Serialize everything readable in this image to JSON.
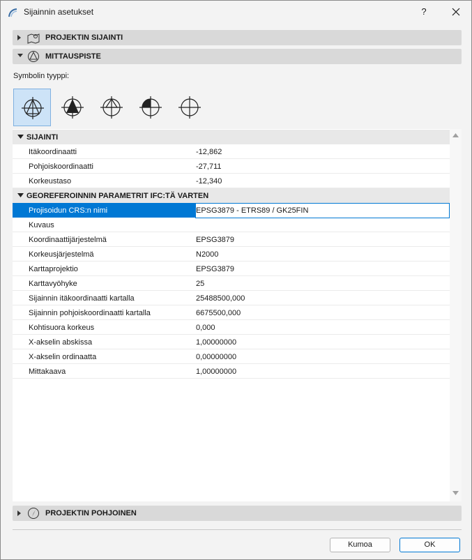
{
  "window": {
    "title": "Sijainnin asetukset",
    "help_label": "?"
  },
  "sections": {
    "project_location": "PROJEKTIN SIJAINTI",
    "survey_point": "MITTAUSPISTE",
    "project_north": "PROJEKTIN POHJOINEN"
  },
  "symbol": {
    "label": "Symbolin tyyppi:",
    "selected_index": 0,
    "options": [
      "survey-symbol-a-icon",
      "survey-symbol-b-icon",
      "survey-symbol-c-icon",
      "survey-symbol-d-icon",
      "survey-symbol-e-icon"
    ]
  },
  "location_group": {
    "title": "SIJAINTI",
    "rows": [
      {
        "name": "Itäkoordinaatti",
        "value": "-12,862"
      },
      {
        "name": "Pohjoiskoordinaatti",
        "value": "-27,711"
      },
      {
        "name": "Korkeustaso",
        "value": "-12,340"
      }
    ]
  },
  "georef_group": {
    "title": "GEOREFEROINNIN PARAMETRIT IFC:TÄ VARTEN",
    "selected_row": 0,
    "rows": [
      {
        "name": "Projisoidun CRS:n nimi",
        "value": "EPSG3879 - ETRS89 / GK25FIN"
      },
      {
        "name": "Kuvaus",
        "value": ""
      },
      {
        "name": "Koordinaattijärjestelmä",
        "value": "EPSG3879"
      },
      {
        "name": "Korkeusjärjestelmä",
        "value": "N2000"
      },
      {
        "name": "Karttaprojektio",
        "value": "EPSG3879"
      },
      {
        "name": "Karttavyöhyke",
        "value": "25"
      },
      {
        "name": "Sijainnin itäkoordinaatti kartalla",
        "value": "25488500,000"
      },
      {
        "name": "Sijainnin pohjoiskoordinaatti kartalla",
        "value": "6675500,000"
      },
      {
        "name": "Kohtisuora korkeus",
        "value": "0,000"
      },
      {
        "name": "X-akselin abskissa",
        "value": "1,00000000"
      },
      {
        "name": "X-akselin ordinaatta",
        "value": "0,00000000"
      },
      {
        "name": "Mittakaava",
        "value": "1,00000000"
      }
    ]
  },
  "buttons": {
    "cancel": "Kumoa",
    "ok": "OK"
  },
  "colors": {
    "selection": "#0078d4",
    "selected_symbol_bg": "#cde3f7"
  }
}
